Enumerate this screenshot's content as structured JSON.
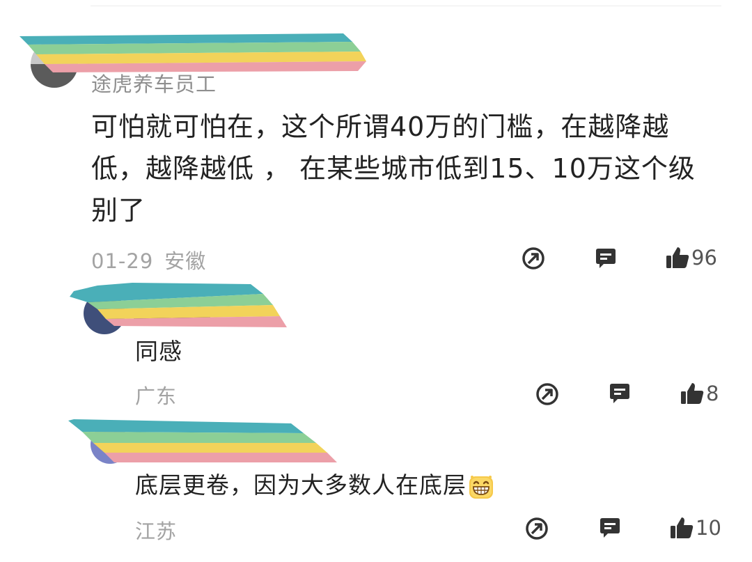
{
  "colors": {
    "text": "#222222",
    "meta": "#a3a3a3",
    "icon": "#333333",
    "redact_stripes": [
      "#4aafb8",
      "#8ccf96",
      "#f2d35a",
      "#ec9fa8"
    ]
  },
  "comment": {
    "subtitle": "途虎养车员工",
    "text": "可怕就可怕在，这个所谓40万的门槛，在越降越低，越降越低 ， 在某些城市低到15、10万这个级别了",
    "date": "01-29",
    "location": "安徽",
    "likes": "96"
  },
  "replies": [
    {
      "text": "同感",
      "location": "广东",
      "likes": "8"
    },
    {
      "text": "底层更卷，因为大多数人在底层",
      "location": "江苏",
      "likes": "10",
      "emoji": "grinning-face-emoji"
    }
  ]
}
